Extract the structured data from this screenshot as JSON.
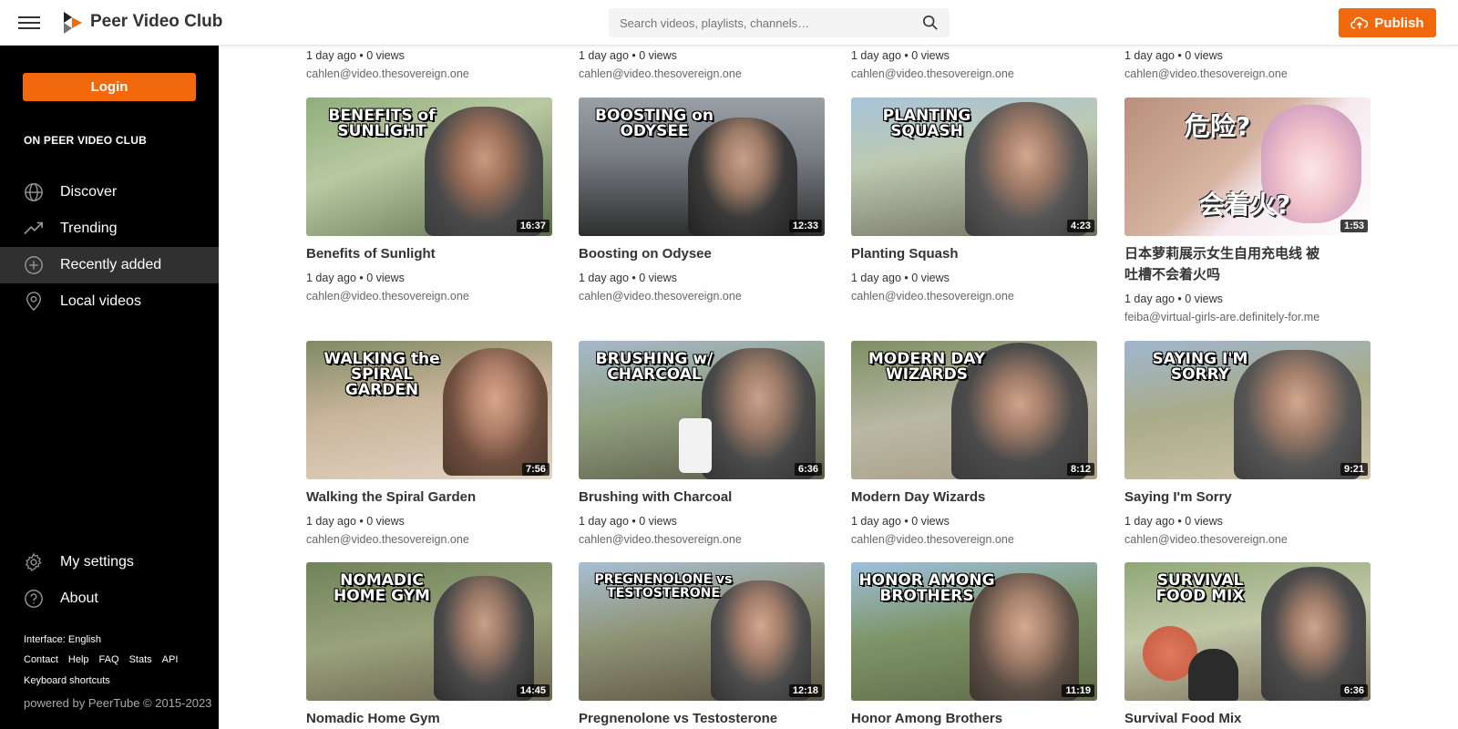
{
  "header": {
    "brand": "Peer Video Club",
    "search_placeholder": "Search videos, playlists, channels…",
    "publish_label": "Publish"
  },
  "sidebar": {
    "login_label": "Login",
    "section_title": "ON PEER VIDEO CLUB",
    "items": [
      {
        "label": "Discover",
        "icon": "globe-icon"
      },
      {
        "label": "Trending",
        "icon": "trending-icon"
      },
      {
        "label": "Recently added",
        "icon": "plus-circle-icon"
      },
      {
        "label": "Local videos",
        "icon": "location-pin-icon"
      }
    ],
    "bottom_items": [
      {
        "label": "My settings",
        "icon": "gear-icon"
      },
      {
        "label": "About",
        "icon": "help-circle-icon"
      }
    ],
    "interface_language": "Interface: English",
    "footer_links": [
      "Contact",
      "Help",
      "FAQ",
      "Stats",
      "API"
    ],
    "keyboard_shortcuts": "Keyboard shortcuts",
    "powered_by": "powered by PeerTube © 2015-2023"
  },
  "top_partial_row": [
    {
      "meta": "1 day ago • 0 views",
      "account": "cahlen@video.thesovereign.one"
    },
    {
      "meta": "1 day ago • 0 views",
      "account": "cahlen@video.thesovereign.one"
    },
    {
      "meta": "1 day ago • 0 views",
      "account": "cahlen@video.thesovereign.one"
    },
    {
      "meta": "1 day ago • 0 views",
      "account": "cahlen@video.thesovereign.one"
    }
  ],
  "videos": [
    {
      "title": "Benefits of Sunlight",
      "duration": "16:37",
      "caption": "BENEFITS of SUNLIGHT",
      "meta": "1 day ago • 0 views",
      "account": "cahlen@video.thesovereign.one"
    },
    {
      "title": "Boosting on Odysee",
      "duration": "12:33",
      "caption": "BOOSTING on ODYSEE",
      "meta": "1 day ago • 0 views",
      "account": "cahlen@video.thesovereign.one"
    },
    {
      "title": "Planting Squash",
      "duration": "4:23",
      "caption": "PLANTING SQUASH",
      "meta": "1 day ago • 0 views",
      "account": "cahlen@video.thesovereign.one"
    },
    {
      "title": "日本萝莉展示女生自用充电线 被吐槽不会着火吗",
      "title_line1": "日本萝莉展示女生自用充电线 被",
      "title_line2": "吐槽不会着火吗",
      "duration": "1:53",
      "caption": "危险?",
      "caption2": "会着火?",
      "meta": "1 day ago • 0 views",
      "account": "feiba@virtual-girls-are.definitely-for.me"
    },
    {
      "title": "Walking the Spiral Garden",
      "duration": "7:56",
      "caption": "WALKING the SPIRAL GARDEN",
      "meta": "1 day ago • 0 views",
      "account": "cahlen@video.thesovereign.one"
    },
    {
      "title": "Brushing with Charcoal",
      "duration": "6:36",
      "caption": "BRUSHING w/ CHARCOAL",
      "meta": "1 day ago • 0 views",
      "account": "cahlen@video.thesovereign.one"
    },
    {
      "title": "Modern Day Wizards",
      "duration": "8:12",
      "caption": "MODERN DAY WIZARDS",
      "meta": "1 day ago • 0 views",
      "account": "cahlen@video.thesovereign.one"
    },
    {
      "title": "Saying I'm Sorry",
      "duration": "9:21",
      "caption": "SAYING I'M SORRY",
      "meta": "1 day ago • 0 views",
      "account": "cahlen@video.thesovereign.one"
    },
    {
      "title": "Nomadic Home Gym",
      "duration": "14:45",
      "caption": "NOMADIC HOME GYM"
    },
    {
      "title": "Pregnenolone vs Testosterone",
      "duration": "12:18",
      "caption": "PREGNENOLONE vs TESTOSTERONE"
    },
    {
      "title": "Honor Among Brothers",
      "duration": "11:19",
      "caption": "HONOR AMONG BROTHERS"
    },
    {
      "title": "Survival Food Mix",
      "duration": "6:36",
      "caption": "SURVIVAL FOOD MIX"
    }
  ],
  "colors": {
    "accent": "#f1680d",
    "sidebar_bg": "#000000",
    "active_item_bg": "#303030"
  }
}
